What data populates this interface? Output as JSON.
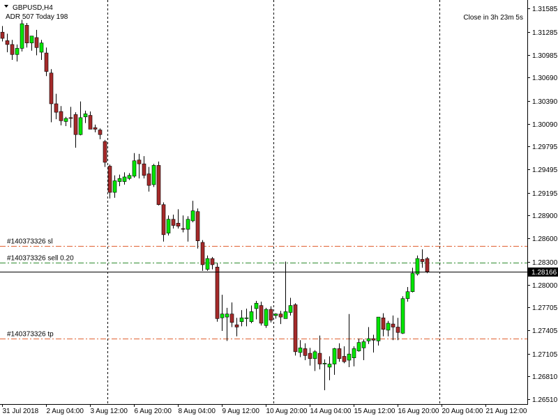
{
  "header": {
    "symbol_label": "GBPUSD,H4",
    "adr_label": "ADR 507  Today 198",
    "countdown": "Close in 3h 23m 5s"
  },
  "colors": {
    "background": "#ffffff",
    "bull": "#00e600",
    "bear": "#a52a2a",
    "wick": "#000000",
    "sl_line": "#e06030",
    "sell_line": "#2e8b2e",
    "tp_line": "#e06030",
    "price_line": "#000000",
    "price_tag_bg": "#000000",
    "price_tag_text": "#ffffff"
  },
  "order_lines": [
    {
      "label": "#140373326 sl",
      "price": 1.285,
      "style": "dashdot",
      "color_key": "sl_line"
    },
    {
      "label": "#140373326 sell 0.20",
      "price": 1.2829,
      "style": "dashdot",
      "color_key": "sell_line"
    },
    {
      "label": "#140373326 tp",
      "price": 1.273,
      "style": "dashdot",
      "color_key": "tp_line"
    }
  ],
  "current_price": {
    "label": "1.28166",
    "value": 1.28166
  },
  "chart_data": {
    "type": "candlestick",
    "title": "GBPUSD,H4",
    "ylim": [
      1.2645,
      1.3168
    ],
    "yticks": [
      "1.31585",
      "1.31285",
      "1.30985",
      "1.30690",
      "1.30390",
      "1.30090",
      "1.29795",
      "1.29495",
      "1.29195",
      "1.28900",
      "1.28600",
      "1.28300",
      "1.28000",
      "1.27705",
      "1.27405",
      "1.27105",
      "1.26810",
      "1.26510"
    ],
    "ytick_values": [
      1.31585,
      1.31285,
      1.30985,
      1.3069,
      1.3039,
      1.3009,
      1.29795,
      1.29495,
      1.29195,
      1.289,
      1.286,
      1.283,
      1.28,
      1.27705,
      1.27405,
      1.27105,
      1.2681,
      1.2651
    ],
    "xticks": [
      "31 Jul 2018",
      "2 Aug 04:00",
      "3 Aug 12:00",
      "6 Aug 20:00",
      "8 Aug 04:00",
      "9 Aug 12:00",
      "10 Aug 20:00",
      "14 Aug 04:00",
      "15 Aug 12:00",
      "16 Aug 20:00",
      "20 Aug 04:00",
      "21 Aug 12:00"
    ],
    "xtick_indices": [
      0,
      9,
      18,
      27,
      36,
      45,
      54,
      63,
      72,
      81,
      90,
      99
    ],
    "session_separators": [
      21.5,
      55.5,
      89.5
    ],
    "grid": false,
    "candles": [
      {
        "o": 1.3128,
        "h": 1.3136,
        "l": 1.3116,
        "c": 1.312
      },
      {
        "o": 1.3117,
        "h": 1.3126,
        "l": 1.3102,
        "c": 1.3112
      },
      {
        "o": 1.3112,
        "h": 1.3118,
        "l": 1.3092,
        "c": 1.3099
      },
      {
        "o": 1.3099,
        "h": 1.3112,
        "l": 1.309,
        "c": 1.3107
      },
      {
        "o": 1.3107,
        "h": 1.3144,
        "l": 1.3103,
        "c": 1.3139
      },
      {
        "o": 1.3137,
        "h": 1.314,
        "l": 1.3108,
        "c": 1.3114
      },
      {
        "o": 1.3114,
        "h": 1.3123,
        "l": 1.3104,
        "c": 1.3123
      },
      {
        "o": 1.3121,
        "h": 1.3131,
        "l": 1.3098,
        "c": 1.3108
      },
      {
        "o": 1.3102,
        "h": 1.3118,
        "l": 1.3092,
        "c": 1.3114
      },
      {
        "o": 1.3101,
        "h": 1.3108,
        "l": 1.3071,
        "c": 1.3077
      },
      {
        "o": 1.3075,
        "h": 1.308,
        "l": 1.3011,
        "c": 1.3035
      },
      {
        "o": 1.3035,
        "h": 1.3048,
        "l": 1.3015,
        "c": 1.3024
      },
      {
        "o": 1.3025,
        "h": 1.3032,
        "l": 1.3007,
        "c": 1.3013
      },
      {
        "o": 1.3012,
        "h": 1.3018,
        "l": 1.3006,
        "c": 1.3016
      },
      {
        "o": 1.3017,
        "h": 1.3031,
        "l": 1.3004,
        "c": 1.3016
      },
      {
        "o": 1.3021,
        "h": 1.3024,
        "l": 1.2978,
        "c": 1.2995
      },
      {
        "o": 1.2995,
        "h": 1.3038,
        "l": 1.2994,
        "c": 1.3017
      },
      {
        "o": 1.3018,
        "h": 1.3026,
        "l": 1.301,
        "c": 1.3022
      },
      {
        "o": 1.302,
        "h": 1.3025,
        "l": 1.3003,
        "c": 1.3002
      },
      {
        "o": 1.3004,
        "h": 1.3008,
        "l": 1.2998,
        "c": 1.3002
      },
      {
        "o": 1.3001,
        "h": 1.3003,
        "l": 1.2989,
        "c": 1.2995
      },
      {
        "o": 1.2986,
        "h": 1.2988,
        "l": 1.2953,
        "c": 1.2959
      },
      {
        "o": 1.2954,
        "h": 1.2956,
        "l": 1.2912,
        "c": 1.292
      },
      {
        "o": 1.292,
        "h": 1.2942,
        "l": 1.2913,
        "c": 1.2935
      },
      {
        "o": 1.2934,
        "h": 1.2943,
        "l": 1.2928,
        "c": 1.2938
      },
      {
        "o": 1.2934,
        "h": 1.2946,
        "l": 1.293,
        "c": 1.294
      },
      {
        "o": 1.2938,
        "h": 1.2945,
        "l": 1.2936,
        "c": 1.2942
      },
      {
        "o": 1.2941,
        "h": 1.2971,
        "l": 1.2939,
        "c": 1.2961
      },
      {
        "o": 1.2962,
        "h": 1.297,
        "l": 1.2938,
        "c": 1.2957
      },
      {
        "o": 1.2957,
        "h": 1.2967,
        "l": 1.2938,
        "c": 1.2942
      },
      {
        "o": 1.2944,
        "h": 1.2953,
        "l": 1.2921,
        "c": 1.2929
      },
      {
        "o": 1.293,
        "h": 1.2957,
        "l": 1.2927,
        "c": 1.2955
      },
      {
        "o": 1.2955,
        "h": 1.296,
        "l": 1.2903,
        "c": 1.2904
      },
      {
        "o": 1.2904,
        "h": 1.2907,
        "l": 1.2856,
        "c": 1.2865
      },
      {
        "o": 1.2867,
        "h": 1.289,
        "l": 1.2864,
        "c": 1.2885
      },
      {
        "o": 1.2885,
        "h": 1.2891,
        "l": 1.2873,
        "c": 1.2877
      },
      {
        "o": 1.288,
        "h": 1.2898,
        "l": 1.2873,
        "c": 1.2876
      },
      {
        "o": 1.2873,
        "h": 1.289,
        "l": 1.2868,
        "c": 1.2872
      },
      {
        "o": 1.2872,
        "h": 1.2889,
        "l": 1.2856,
        "c": 1.2885
      },
      {
        "o": 1.2883,
        "h": 1.2909,
        "l": 1.2881,
        "c": 1.2896
      },
      {
        "o": 1.2895,
        "h": 1.2899,
        "l": 1.2847,
        "c": 1.2857
      },
      {
        "o": 1.2855,
        "h": 1.2858,
        "l": 1.2818,
        "c": 1.2826
      },
      {
        "o": 1.282,
        "h": 1.2838,
        "l": 1.2818,
        "c": 1.2834
      },
      {
        "o": 1.2834,
        "h": 1.2836,
        "l": 1.282,
        "c": 1.2826
      },
      {
        "o": 1.2823,
        "h": 1.2828,
        "l": 1.2752,
        "c": 1.2756
      },
      {
        "o": 1.2757,
        "h": 1.2787,
        "l": 1.274,
        "c": 1.2762
      },
      {
        "o": 1.2758,
        "h": 1.277,
        "l": 1.2727,
        "c": 1.2762
      },
      {
        "o": 1.2762,
        "h": 1.2777,
        "l": 1.2745,
        "c": 1.2751
      },
      {
        "o": 1.2748,
        "h": 1.2757,
        "l": 1.2733,
        "c": 1.2745
      },
      {
        "o": 1.2752,
        "h": 1.2767,
        "l": 1.2746,
        "c": 1.2757
      },
      {
        "o": 1.2757,
        "h": 1.2769,
        "l": 1.2746,
        "c": 1.2757
      },
      {
        "o": 1.2752,
        "h": 1.2773,
        "l": 1.275,
        "c": 1.2765
      },
      {
        "o": 1.2769,
        "h": 1.2779,
        "l": 1.2755,
        "c": 1.2776
      },
      {
        "o": 1.2773,
        "h": 1.2778,
        "l": 1.2747,
        "c": 1.275
      },
      {
        "o": 1.2747,
        "h": 1.277,
        "l": 1.2744,
        "c": 1.2768
      },
      {
        "o": 1.2768,
        "h": 1.2772,
        "l": 1.2751,
        "c": 1.2754
      },
      {
        "o": 1.276,
        "h": 1.2763,
        "l": 1.2756,
        "c": 1.2762
      },
      {
        "o": 1.2762,
        "h": 1.2766,
        "l": 1.2749,
        "c": 1.2758
      },
      {
        "o": 1.2756,
        "h": 1.283,
        "l": 1.2756,
        "c": 1.2765
      },
      {
        "o": 1.2764,
        "h": 1.2783,
        "l": 1.276,
        "c": 1.2773
      },
      {
        "o": 1.2774,
        "h": 1.2776,
        "l": 1.2708,
        "c": 1.2713
      },
      {
        "o": 1.2712,
        "h": 1.2728,
        "l": 1.2706,
        "c": 1.2718
      },
      {
        "o": 1.2717,
        "h": 1.2724,
        "l": 1.2702,
        "c": 1.2708
      },
      {
        "o": 1.2711,
        "h": 1.2718,
        "l": 1.2695,
        "c": 1.2704
      },
      {
        "o": 1.2704,
        "h": 1.2715,
        "l": 1.2688,
        "c": 1.2713
      },
      {
        "o": 1.2711,
        "h": 1.2734,
        "l": 1.269,
        "c": 1.2697
      },
      {
        "o": 1.2697,
        "h": 1.2703,
        "l": 1.2663,
        "c": 1.2698
      },
      {
        "o": 1.2693,
        "h": 1.2707,
        "l": 1.2676,
        "c": 1.2697
      },
      {
        "o": 1.2697,
        "h": 1.2718,
        "l": 1.2683,
        "c": 1.2717
      },
      {
        "o": 1.2717,
        "h": 1.2724,
        "l": 1.27,
        "c": 1.2704
      },
      {
        "o": 1.2707,
        "h": 1.272,
        "l": 1.2698,
        "c": 1.27
      },
      {
        "o": 1.2702,
        "h": 1.2762,
        "l": 1.2693,
        "c": 1.271
      },
      {
        "o": 1.2705,
        "h": 1.272,
        "l": 1.2694,
        "c": 1.2717
      },
      {
        "o": 1.2714,
        "h": 1.273,
        "l": 1.2713,
        "c": 1.2725
      },
      {
        "o": 1.2718,
        "h": 1.2729,
        "l": 1.2702,
        "c": 1.2726
      },
      {
        "o": 1.2727,
        "h": 1.2745,
        "l": 1.2723,
        "c": 1.273
      },
      {
        "o": 1.273,
        "h": 1.2735,
        "l": 1.2712,
        "c": 1.2728
      },
      {
        "o": 1.2727,
        "h": 1.2758,
        "l": 1.2721,
        "c": 1.2758
      },
      {
        "o": 1.2757,
        "h": 1.2763,
        "l": 1.2733,
        "c": 1.2742
      },
      {
        "o": 1.2741,
        "h": 1.2753,
        "l": 1.2733,
        "c": 1.275
      },
      {
        "o": 1.2749,
        "h": 1.276,
        "l": 1.2728,
        "c": 1.2745
      },
      {
        "o": 1.2745,
        "h": 1.2757,
        "l": 1.2728,
        "c": 1.2738
      },
      {
        "o": 1.2737,
        "h": 1.2785,
        "l": 1.2736,
        "c": 1.2782
      },
      {
        "o": 1.2782,
        "h": 1.2797,
        "l": 1.2778,
        "c": 1.2791
      },
      {
        "o": 1.2791,
        "h": 1.2822,
        "l": 1.279,
        "c": 1.2815
      },
      {
        "o": 1.2814,
        "h": 1.2838,
        "l": 1.2812,
        "c": 1.2834
      },
      {
        "o": 1.2833,
        "h": 1.2846,
        "l": 1.2822,
        "c": 1.283
      },
      {
        "o": 1.2834,
        "h": 1.2836,
        "l": 1.2815,
        "c": 1.2817
      }
    ]
  }
}
